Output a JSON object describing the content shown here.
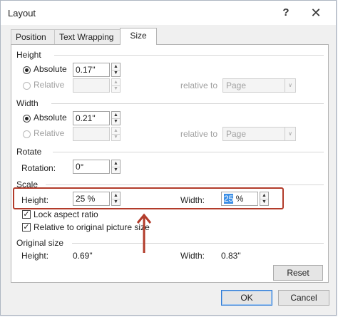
{
  "window": {
    "title": "Layout",
    "help_glyph": "?",
    "close_glyph": "✕"
  },
  "tabs": [
    {
      "label": "Position",
      "active": false
    },
    {
      "label": "Text Wrapping",
      "active": false
    },
    {
      "label": "Size",
      "active": true
    }
  ],
  "height": {
    "group_label": "Height",
    "absolute_label": "Absolute",
    "absolute_value": "0.17\"",
    "relative_label": "Relative",
    "relative_value": "",
    "relative_to_label": "relative to",
    "relative_to_value": "Page"
  },
  "width": {
    "group_label": "Width",
    "absolute_label": "Absolute",
    "absolute_value": "0.21\"",
    "relative_label": "Relative",
    "relative_value": "",
    "relative_to_label": "relative to",
    "relative_to_value": "Page"
  },
  "rotate": {
    "group_label": "Rotate",
    "rotation_label": "Rotation:",
    "rotation_value": "0°"
  },
  "scale": {
    "group_label": "Scale",
    "height_label": "Height:",
    "height_value": "25 %",
    "width_label": "Width:",
    "width_value_selected": "25",
    "width_value_rest": " %",
    "lock_aspect_label": "Lock aspect ratio",
    "lock_aspect_checked": true,
    "relative_original_label": "Relative to original picture size",
    "relative_original_checked": true
  },
  "original_size": {
    "group_label": "Original size",
    "height_label": "Height:",
    "height_value": "0.69\"",
    "width_label": "Width:",
    "width_value": "0.83\""
  },
  "buttons": {
    "reset": "Reset",
    "ok": "OK",
    "cancel": "Cancel"
  },
  "icons": {
    "spin_up": "▲",
    "spin_down": "▼",
    "dropdown": "∨",
    "check": "✓"
  },
  "colors": {
    "highlight_box": "#b23b2a",
    "arrow": "#b23b2a",
    "selection": "#3a8ee6"
  }
}
